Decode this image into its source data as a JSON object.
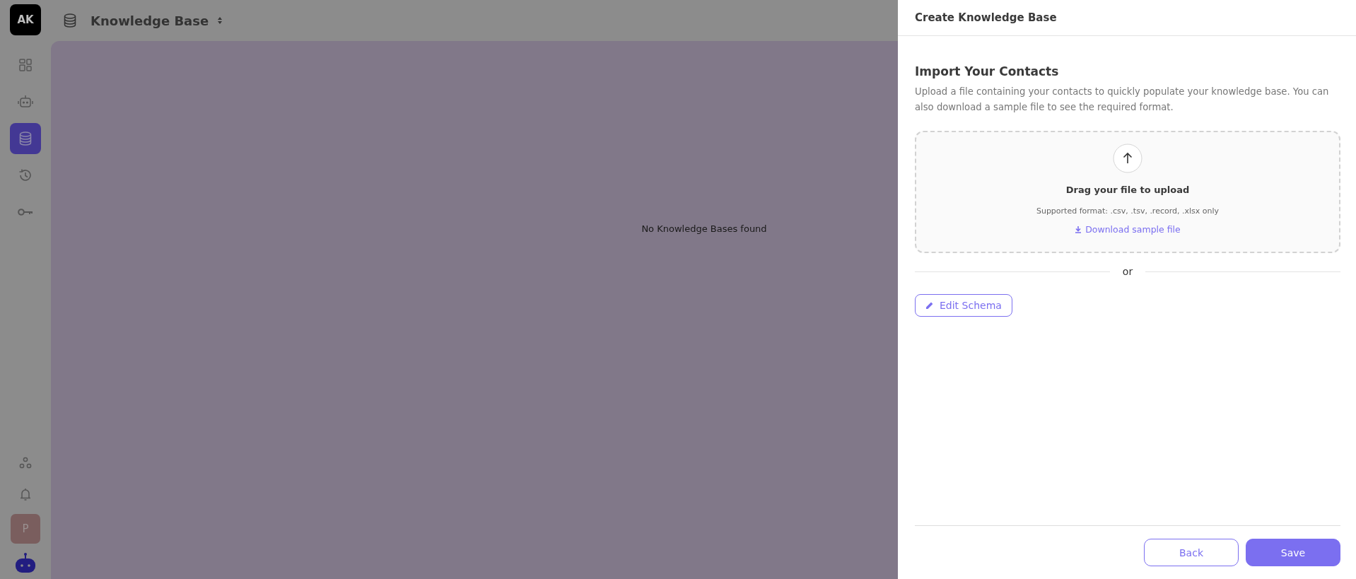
{
  "app_logo": {
    "text": "AK"
  },
  "sidebar": {
    "items": [
      {
        "kind": "grid",
        "selected": false
      },
      {
        "kind": "robot",
        "selected": false
      },
      {
        "kind": "database",
        "selected": true
      },
      {
        "kind": "history",
        "selected": false
      },
      {
        "kind": "key",
        "selected": false
      }
    ],
    "bottom_items": [
      {
        "kind": "nodes"
      },
      {
        "kind": "bell"
      }
    ],
    "avatar": {
      "text": "P"
    }
  },
  "header": {
    "title": "Knowledge Base"
  },
  "main": {
    "empty_message": "No Knowledge Bases found"
  },
  "drawer": {
    "title": "Create Knowledge Base",
    "heading": "Import Your Contacts",
    "description": "Upload a file containing your contacts to quickly populate your knowledge base. You can also download a sample file to see the required format.",
    "dropzone": {
      "title": "Drag your file to upload",
      "hint": "Supported format: .csv, .tsv, .record, .xlsx only",
      "link": "Download sample file"
    },
    "divider": "or",
    "edit_button": "Edit Schema",
    "buttons": [
      {
        "label": "Back",
        "kind": "secondary"
      },
      {
        "label": "Save",
        "kind": "primary"
      }
    ]
  }
}
